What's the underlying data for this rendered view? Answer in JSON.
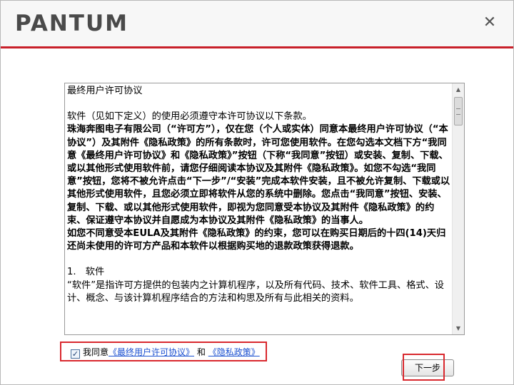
{
  "header": {
    "logo_text": "PANTUM",
    "close_glyph": "✕"
  },
  "eula": {
    "title": "最终用户许可协议",
    "intro": "软件（见如下定义）的使用必须遵守本许可协议以下条款。",
    "bold_paragraph": "珠海奔图电子有限公司（“许可方”），仅在您（个人或实体）同意本最终用户许可协议（“本协议”）及其附件《隐私政策》的所有条款时，许可您使用软件。在您勾选本文档下方“我同意《最终用户许可协议》和《隐私政策》”按钮（下称“我同意”按钮）或安装、复制、下载、或以其他形式使用软件前，请您仔细阅读本协议及其附件《隐私政策》。如您不勾选“我同意”按钮，您将不被允许点击“下一步”/“安装”完成本软件安装，且不被允许复制、下载或以其他形式使用软件，且您必须立即将软件从您的系统中删除。您点击“我同意”按钮、安装、复制、下载、或以其他形式使用软件，即视为您同意受本协议及其附件《隐私政策》的约束、保证遵守本协议并自愿成为本协议及其附件《隐私政策》的当事人。",
    "bold_paragraph_2": "如您不同意受本EULA及其附件《隐私政策》的约束，您可以在购买日期后的十四(14)天归还尚未使用的许可方产品和本软件以根据购买地的退款政策获得退款。",
    "section1_heading": "1.　软件",
    "section1_body": "“软件”是指许可方提供的包装内之计算机程序，以及所有代码、技术、软件工具、格式、设计、概念、与该计算机程序结合的方法和构思及所有与此相关的资料。"
  },
  "scrollbar": {
    "up_glyph": "▲",
    "down_glyph": "▼"
  },
  "agree": {
    "checked": true,
    "check_glyph": "✓",
    "prefix": "我同意",
    "eula_link": "《最终用户许可协议》",
    "and": "和",
    "privacy_link": "《隐私政策》"
  },
  "footer": {
    "next_label": "下一步"
  },
  "colors": {
    "accent_red": "#c8202a",
    "link_blue": "#1a4fd0",
    "logo_gray": "#4a4a4a"
  }
}
